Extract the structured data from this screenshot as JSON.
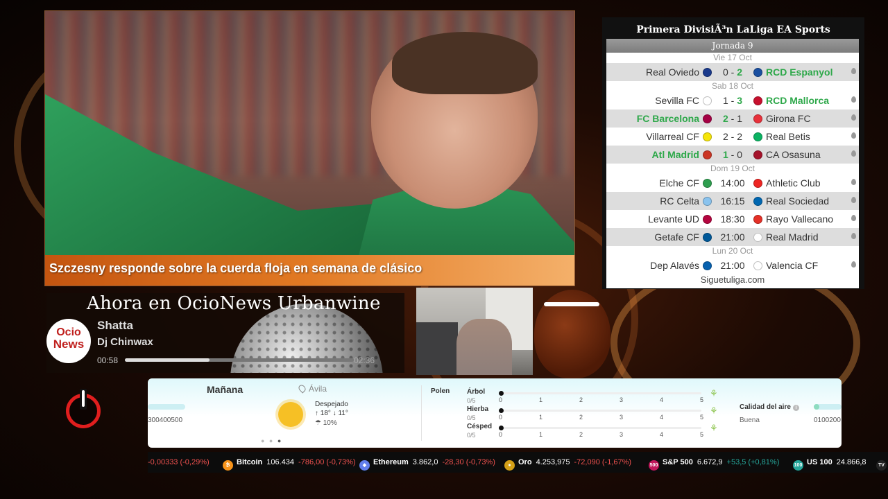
{
  "news": {
    "headline": "Szczesny responde sobre la cuerda floja en semana de clásico"
  },
  "league": {
    "title": "Primera DivisiÃ³n LaLiga EA Sports",
    "round": "Jornada 9",
    "footer": "Siguetuliga.com",
    "days": [
      {
        "label": "Vie 17 Oct",
        "matches": [
          {
            "home": "Real Oviedo",
            "score": "0 - 2",
            "away": "RCD Espanyol",
            "winner": "away",
            "home_color": "#1a3a8c",
            "away_color": "#1a4fa0",
            "shaded": true
          }
        ]
      },
      {
        "label": "Sab 18 Oct",
        "matches": [
          {
            "home": "Sevilla FC",
            "score": "1 - 3",
            "away": "RCD Mallorca",
            "winner": "away",
            "home_color": "#ffffff",
            "away_color": "#c8102e",
            "shaded": false
          },
          {
            "home": "FC Barcelona",
            "score": "2 - 1",
            "away": "Girona FC",
            "winner": "home",
            "home_color": "#a50044",
            "away_color": "#e8313b",
            "shaded": true
          },
          {
            "home": "Villarreal CF",
            "score": "2 - 2",
            "away": "Real Betis",
            "winner": "none",
            "home_color": "#f5e50a",
            "away_color": "#0bb363",
            "shaded": false
          },
          {
            "home": "Atl Madrid",
            "score": "1 - 0",
            "away": "CA Osasuna",
            "winner": "home",
            "home_color": "#cb3524",
            "away_color": "#a5122a",
            "shaded": true
          }
        ]
      },
      {
        "label": "Dom 19 Oct",
        "matches": [
          {
            "home": "Elche CF",
            "score": "14:00",
            "away": "Athletic Club",
            "winner": "none",
            "home_color": "#2e9e4f",
            "away_color": "#ee2523",
            "shaded": false
          },
          {
            "home": "RC Celta",
            "score": "16:15",
            "away": "Real Sociedad",
            "winner": "none",
            "home_color": "#8ac3ee",
            "away_color": "#0067b1",
            "shaded": true
          },
          {
            "home": "Levante UD",
            "score": "18:30",
            "away": "Rayo Vallecano",
            "winner": "none",
            "home_color": "#b4053f",
            "away_color": "#e53027",
            "shaded": false
          },
          {
            "home": "Getafe CF",
            "score": "21:00",
            "away": "Real Madrid",
            "winner": "none",
            "home_color": "#005999",
            "away_color": "#ffffff",
            "shaded": true
          }
        ]
      },
      {
        "label": "Lun 20 Oct",
        "matches": [
          {
            "home": "Dep Alavés",
            "score": "21:00",
            "away": "Valencia CF",
            "winner": "none",
            "home_color": "#0761af",
            "away_color": "#ffffff",
            "shaded": false
          }
        ]
      }
    ]
  },
  "nowplaying": {
    "heading": "Ahora en OcioNews Urbanwine",
    "logo_line1": "Ocio",
    "logo_line2": "News",
    "song": "Shatta",
    "artist": "Dj Chinwax",
    "elapsed": "00:58",
    "duration": "02:36",
    "progress": 0.37
  },
  "weather": {
    "left_scale": "300400500",
    "title": "Mañana",
    "location": "Ávila",
    "condition": "Despejado",
    "temps": "↑ 18°  ↓ 11°",
    "rain": "☂ 10%",
    "polen_label": "Polen",
    "pollen": [
      {
        "name": "Árbol",
        "value": "0/5"
      },
      {
        "name": "Hierba",
        "value": "0/5"
      },
      {
        "name": "Césped",
        "value": "0/5"
      }
    ],
    "scale": [
      "0",
      "1",
      "2",
      "3",
      "4",
      "5"
    ],
    "air_title": "Calidad del aire",
    "air_value": "Buena",
    "air_scale": "0100200"
  },
  "ticker": [
    {
      "name": "",
      "price": "",
      "change": "-0,00333 (-0,29%)",
      "dir": "neg",
      "icon": "",
      "color": "#000000"
    },
    {
      "name": "Bitcoin",
      "price": "106.434",
      "change": "-786,00 (-0,73%)",
      "dir": "neg",
      "icon": "₿",
      "color": "#f7931a"
    },
    {
      "name": "Ethereum",
      "price": "3.862,0",
      "change": "-28,30 (-0,73%)",
      "dir": "neg",
      "icon": "◆",
      "color": "#627eea"
    },
    {
      "name": "Oro",
      "price": "4.253,975",
      "change": "-72,090 (-1,67%)",
      "dir": "neg",
      "icon": "●",
      "color": "#d4a017"
    },
    {
      "name": "S&P 500",
      "price": "6.672,9",
      "change": "+53,5 (+0,81%)",
      "dir": "pos",
      "icon": "500",
      "color": "#c2185b"
    },
    {
      "name": "US 100",
      "price": "24.866,8",
      "change": "",
      "dir": "pos",
      "icon": "100",
      "color": "#26a69a"
    },
    {
      "name": "",
      "price": "",
      "change": "",
      "dir": "pos",
      "icon": "TV",
      "color": "#222222"
    }
  ]
}
